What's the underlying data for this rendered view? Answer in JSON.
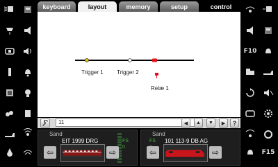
{
  "tabs": [
    {
      "label": "keyboard",
      "active": false
    },
    {
      "label": "layout",
      "active": true
    },
    {
      "label": "memory",
      "active": false
    },
    {
      "label": "setup",
      "active": false
    },
    {
      "label": "control",
      "active": false
    }
  ],
  "right_column": {
    "f10": "F10",
    "f15": "F15"
  },
  "layout": {
    "labels": {
      "trigger1": "Trigger 1",
      "trigger2": "Trigger 2",
      "relay1": "Relæ 1"
    }
  },
  "toolbar": {
    "field_value": "11",
    "help": "?"
  },
  "locos": [
    {
      "address": "Sand",
      "name": "EIT 1999 DRG",
      "fs_label": "FS",
      "fs_value": "0"
    },
    {
      "address": "Sand",
      "name": "101 113-9 DB AG",
      "fs_label": "FS",
      "fs_value": "0"
    }
  ],
  "colors": {
    "trigger_active": "#e6c200",
    "relay": "#e0101e",
    "loco2_body": "#c8161c",
    "speed_meter": "#2f5a2f"
  }
}
